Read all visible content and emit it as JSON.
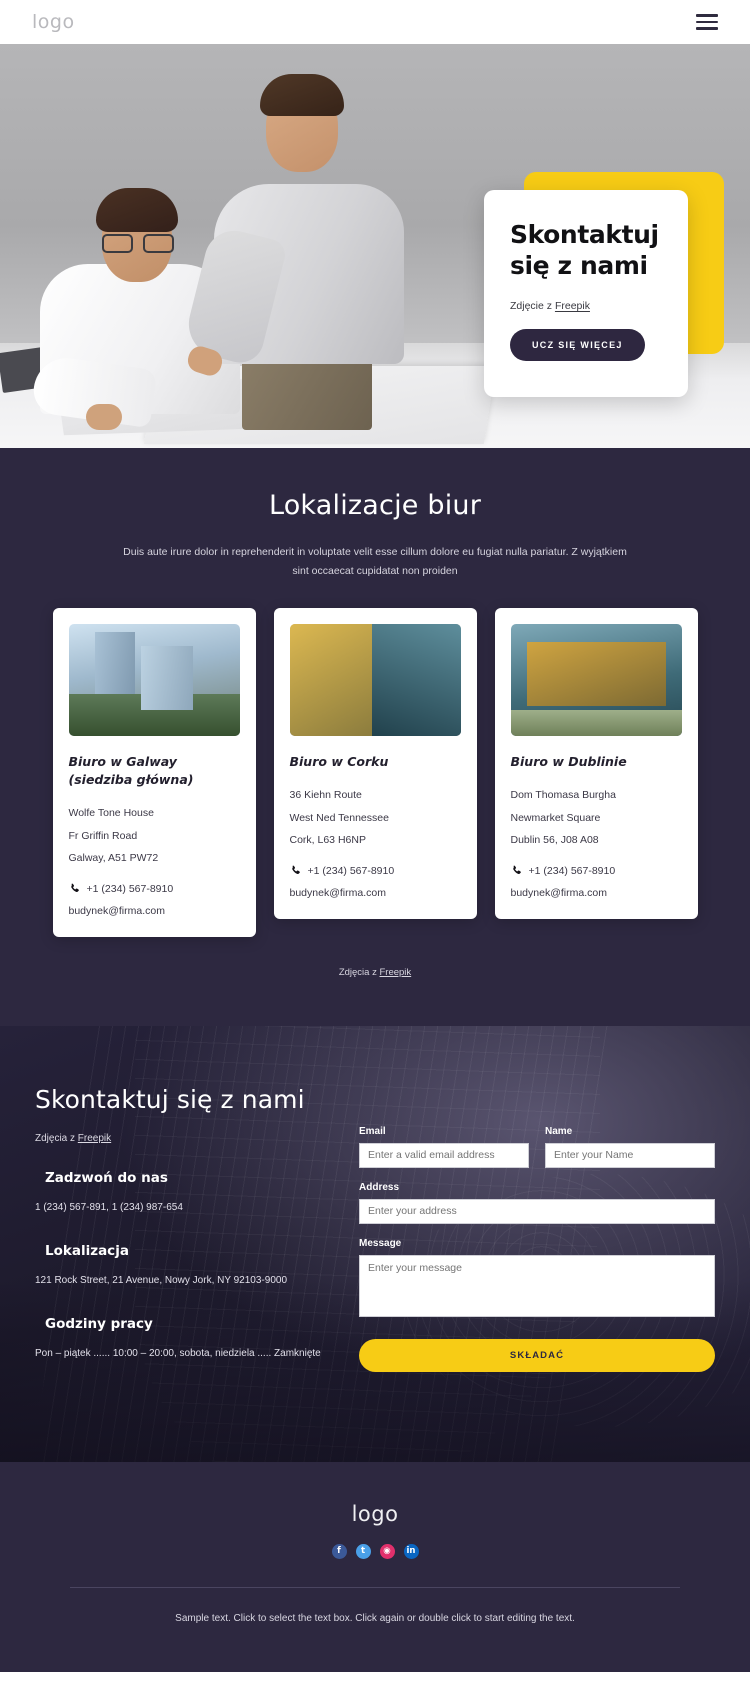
{
  "header": {
    "logo": "logo",
    "menu_icon": "hamburger-icon"
  },
  "hero": {
    "title": "Skontaktuj się z nami",
    "credit_prefix": "Zdjęcie z ",
    "credit_link": "Freepik",
    "button": "UCZ SIĘ WIĘCEJ"
  },
  "locations": {
    "title": "Lokalizacje biur",
    "subtitle": "Duis aute irure dolor in reprehenderit in voluptate velit esse cillum dolore eu fugiat nulla pariatur. Z wyjątkiem sint occaecat cupidatat non proiden",
    "credit_prefix": "Zdjęcia z ",
    "credit_link": "Freepik",
    "cards": [
      {
        "title": "Biuro w Galway (siedziba główna)",
        "address": [
          "Wolfe Tone House",
          "Fr Griffin Road",
          "Galway, A51 PW72"
        ],
        "phone": "+1 (234) 567-8910",
        "email": "budynek@firma.com"
      },
      {
        "title": "Biuro w Corku",
        "address": [
          "36 Kiehn Route",
          "West Ned Tennessee",
          "Cork, L63 H6NP"
        ],
        "phone": "+1 (234) 567-8910",
        "email": "budynek@firma.com"
      },
      {
        "title": "Biuro w Dublinie",
        "address": [
          "Dom Thomasa Burgha",
          "Newmarket Square",
          "Dublin 56, J08 A08"
        ],
        "phone": "+1 (234) 567-8910",
        "email": "budynek@firma.com"
      }
    ]
  },
  "contact": {
    "title": "Skontaktuj się z nami",
    "credit_prefix": "Zdjęcia z ",
    "credit_link": "Freepik",
    "blocks": [
      {
        "heading": "Zadzwoń do nas",
        "text": "1 (234) 567-891, 1 (234) 987-654"
      },
      {
        "heading": "Lokalizacja",
        "text": "121 Rock Street, 21 Avenue, Nowy Jork, NY 92103-9000"
      },
      {
        "heading": "Godziny pracy",
        "text": "Pon – piątek ...... 10:00 – 20:00, sobota, niedziela ..... Zamknięte"
      }
    ],
    "form": {
      "email_label": "Email",
      "email_placeholder": "Enter a valid email address",
      "name_label": "Name",
      "name_placeholder": "Enter your Name",
      "address_label": "Address",
      "address_placeholder": "Enter your address",
      "message_label": "Message",
      "message_placeholder": "Enter your message",
      "submit": "SKŁADAĆ"
    }
  },
  "footer": {
    "logo": "logo",
    "socials": [
      {
        "name": "facebook",
        "glyph": "f"
      },
      {
        "name": "twitter",
        "glyph": "t"
      },
      {
        "name": "instagram",
        "glyph": "◉"
      },
      {
        "name": "linkedin",
        "glyph": "in"
      }
    ],
    "text": "Sample text. Click to select the text box. Click again or double click to start editing the text."
  },
  "colors": {
    "dark": "#2d2840",
    "yellow": "#f7cc15",
    "white": "#ffffff"
  }
}
